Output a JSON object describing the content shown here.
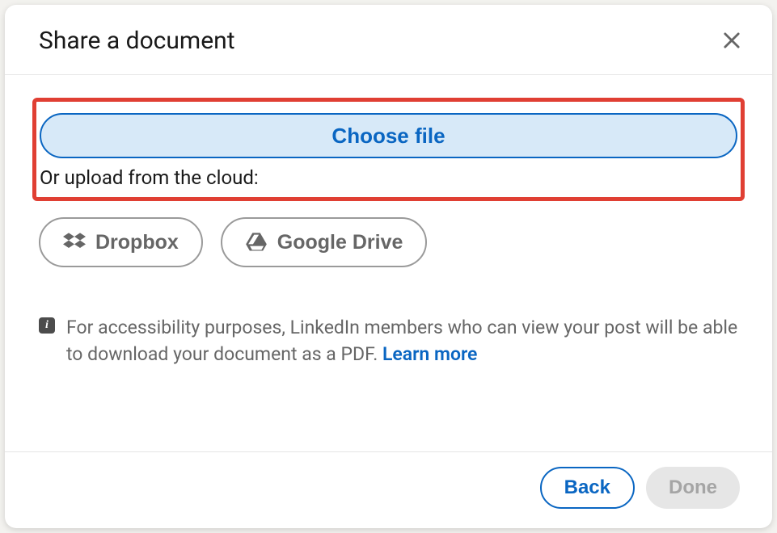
{
  "modal": {
    "title": "Share a document",
    "choose_file_label": "Choose file",
    "or_cloud_label": "Or upload from the cloud:",
    "cloud_options": {
      "dropbox_label": "Dropbox",
      "google_drive_label": "Google Drive"
    },
    "info_text": "For accessibility purposes, LinkedIn members who can view your post will be able to download your document as a PDF.",
    "learn_more_label": "Learn more",
    "footer": {
      "back_label": "Back",
      "done_label": "Done",
      "done_enabled": false
    }
  },
  "highlight": {
    "color": "#e03f33"
  }
}
